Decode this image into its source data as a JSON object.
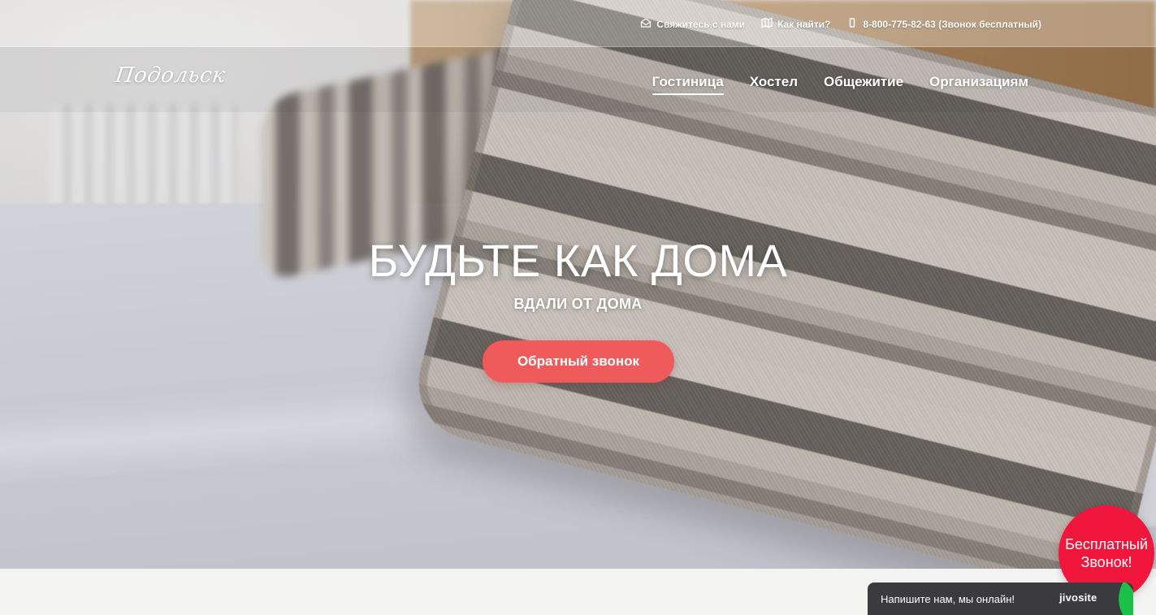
{
  "topbar": {
    "links": [
      {
        "label": "Свяжитесь с нами",
        "icon": "envelope-icon"
      },
      {
        "label": "Как найти?",
        "icon": "map-icon"
      },
      {
        "label": "8-800-775-82-63 (Звонок бесплатный)",
        "icon": "phone-icon"
      }
    ]
  },
  "nav": {
    "logo": "Подольск",
    "menu": [
      {
        "label": "Гостиница",
        "active": true
      },
      {
        "label": "Хостел",
        "active": false
      },
      {
        "label": "Общежитие",
        "active": false
      },
      {
        "label": "Организациям",
        "active": false
      }
    ]
  },
  "hero": {
    "title": "БУДЬТЕ КАК ДОМА",
    "subtitle": "ВДАЛИ ОТ ДОМА",
    "cta_label": "Обратный звонок"
  },
  "widgets": {
    "free_call_line1": "Бесплатный",
    "free_call_line2": "Звонок!",
    "chat_text": "Напишите нам, мы онлайн!",
    "chat_brand": "jivosite"
  },
  "colors": {
    "accent": "#ef5a5a",
    "free_call": "#f0163c",
    "chat_bg": "#3b3b3e",
    "chat_leaf": "#1bc24a"
  }
}
